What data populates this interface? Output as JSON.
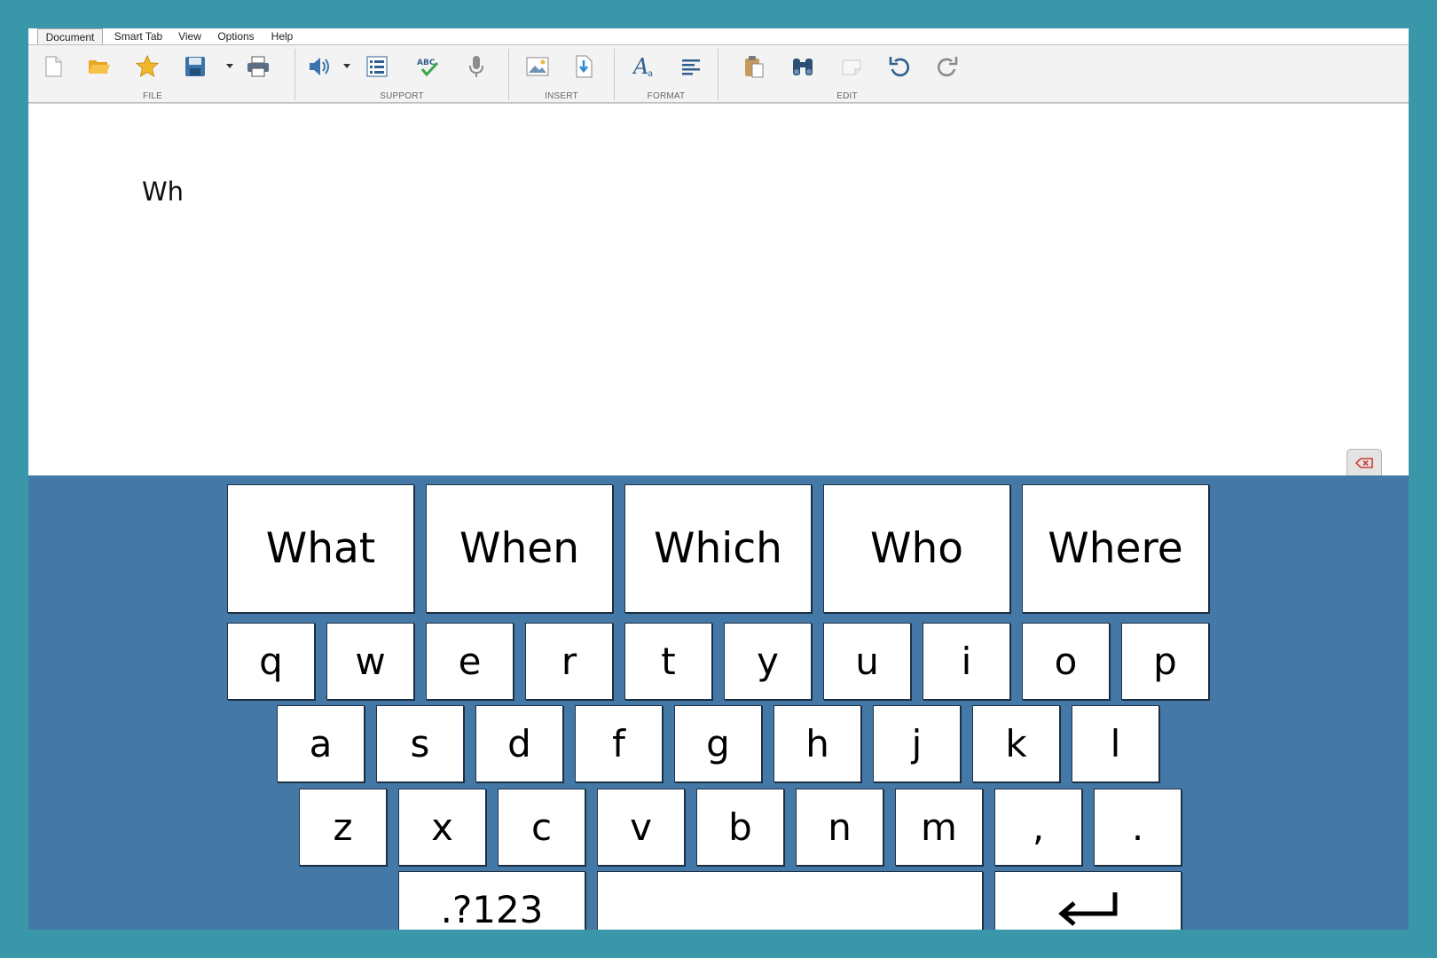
{
  "tabs": [
    "Document",
    "Smart Tab",
    "View",
    "Options",
    "Help"
  ],
  "ribbon": {
    "groups": [
      "FILE",
      "SUPPORT",
      "INSERT",
      "FORMAT",
      "EDIT"
    ],
    "icons": {
      "file": [
        "new-document-icon",
        "open-folder-icon",
        "favorite-star-icon",
        "save-floppy-icon",
        "print-icon"
      ],
      "support": [
        "speaker-icon",
        "numbered-list-icon",
        "spell-check-icon",
        "microphone-icon"
      ],
      "insert": [
        "insert-image-icon",
        "insert-file-icon"
      ],
      "format": [
        "font-style-icon",
        "align-left-icon"
      ],
      "edit": [
        "paste-icon",
        "find-binoculars-icon",
        "eraser-icon",
        "undo-icon",
        "redo-icon"
      ]
    }
  },
  "document": {
    "text": "Wh"
  },
  "keyboard": {
    "predictions": [
      "What",
      "When",
      "Which",
      "Who",
      "Where"
    ],
    "row1": [
      "q",
      "w",
      "e",
      "r",
      "t",
      "y",
      "u",
      "i",
      "o",
      "p"
    ],
    "row2": [
      "a",
      "s",
      "d",
      "f",
      "g",
      "h",
      "j",
      "k",
      "l"
    ],
    "row3": [
      "z",
      "x",
      "c",
      "v",
      "b",
      "n",
      "m",
      ",",
      "."
    ],
    "numbers_label": ".?123",
    "space_label": "",
    "enter_icon": "enter-arrow-icon",
    "delete_icon": "backspace-icon"
  },
  "colors": {
    "frame": "#3a97a9",
    "keyboard_bg": "#4378a7",
    "key_bg": "#ffffff",
    "ribbon_bg": "#f3f3f3"
  }
}
